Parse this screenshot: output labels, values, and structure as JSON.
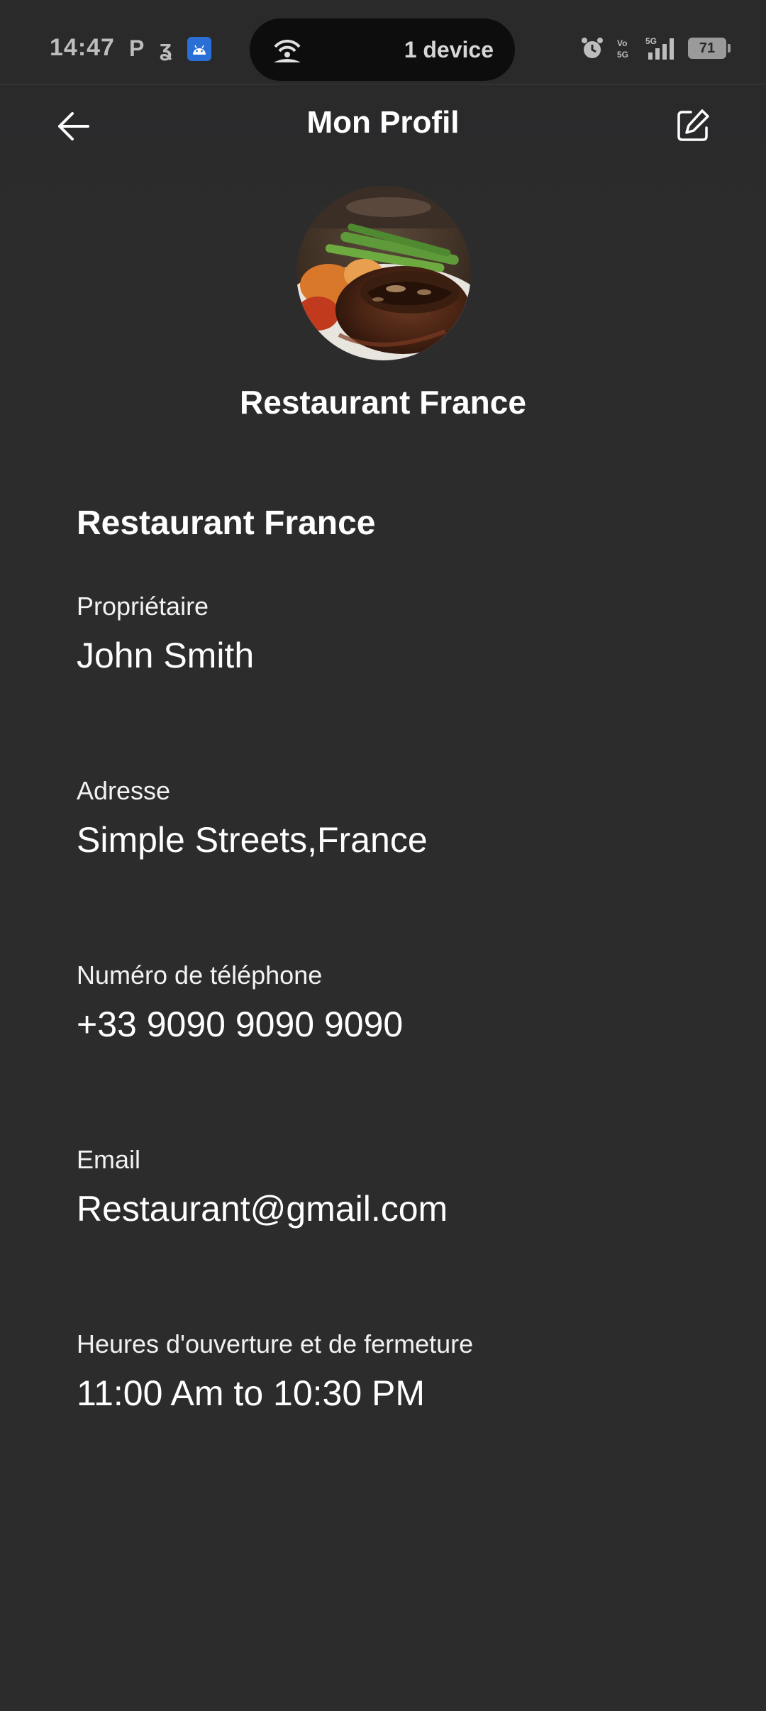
{
  "status_bar": {
    "time": "14:47",
    "left_icons": [
      "P",
      "ʓ"
    ],
    "android_icon": "android-icon",
    "hotspot_text": "1 device",
    "battery": "71"
  },
  "header": {
    "title": "Mon Profil",
    "back_icon": "arrow-left-icon",
    "edit_icon": "edit-icon"
  },
  "profile": {
    "display_name": "Restaurant France",
    "section_title": "Restaurant France",
    "fields": [
      {
        "label": "Propriétaire",
        "value": "John Smith"
      },
      {
        "label": "Adresse",
        "value": "Simple Streets,France"
      },
      {
        "label": "Numéro de téléphone",
        "value": "+33 9090 9090 9090"
      },
      {
        "label": "Email",
        "value": "Restaurant@gmail.com"
      },
      {
        "label": "Heures d'ouverture et de fermeture",
        "value": "11:00 Am to 10:30 PM"
      }
    ]
  },
  "colors": {
    "background": "#2c2c2d",
    "text": "#ffffff"
  }
}
